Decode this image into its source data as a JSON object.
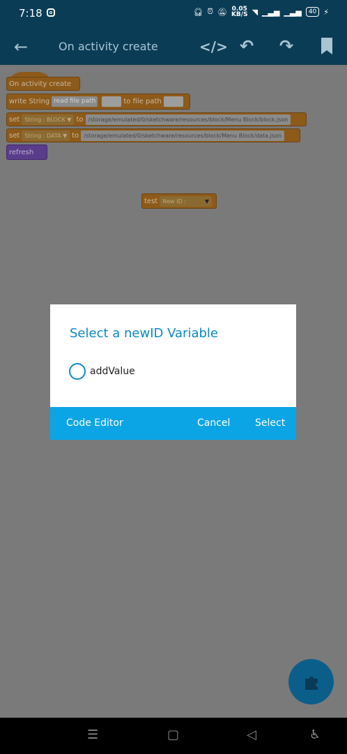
{
  "status": {
    "time": "7:18",
    "speed": "0.05",
    "speed_unit": "KB/S",
    "battery": "40"
  },
  "appbar": {
    "title": "On activity create",
    "code_icon": "</>",
    "undo_icon": "undo-icon",
    "redo_icon": "redo-icon",
    "bookmark_icon": "bookmark-icon"
  },
  "blocks": {
    "event": "On activity create",
    "write": {
      "label": "write String",
      "read": "read file path",
      "to": "to file path"
    },
    "set1": {
      "label": "set",
      "dropdown": "String : BLOCK",
      "to": "to",
      "path": "/storage/emulated/0/sketchware/resources/block/Menu Block/block.json"
    },
    "set2": {
      "label": "set",
      "dropdown": "String : DATA",
      "to": "to",
      "path": "/storage/emulated/0/sketchware/resources/block/Menu Block/data.json"
    },
    "refresh": "refresh",
    "test": {
      "label": "test",
      "dropdown": "New ID :"
    }
  },
  "dialog": {
    "title": "Select a newID Variable",
    "option": "addValue",
    "code_editor": "Code Editor",
    "cancel": "Cancel",
    "select": "Select"
  },
  "colors": {
    "accent": "#0ba5e6",
    "title": "#0b88c8",
    "appbar": "#0b3c56"
  }
}
